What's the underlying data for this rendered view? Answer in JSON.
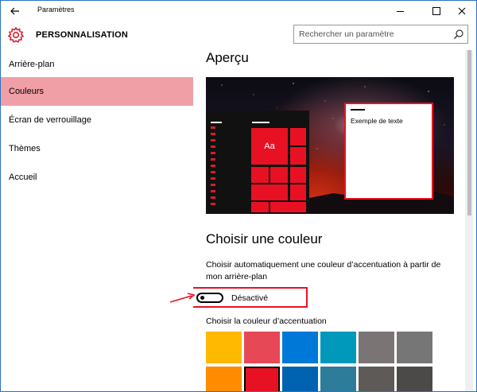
{
  "window": {
    "title": "Paramètres",
    "back_icon": "arrow-left-icon",
    "controls": [
      "minimize-icon",
      "maximize-icon",
      "close-icon"
    ]
  },
  "header": {
    "icon": "gear-icon",
    "title": "PERSONNALISATION",
    "search_placeholder": "Rechercher un paramètre",
    "search_icon": "search-icon",
    "accent": "#d61e2b"
  },
  "sidebar": {
    "items": [
      {
        "label": "Arrière-plan",
        "active": false
      },
      {
        "label": "Couleurs",
        "active": true
      },
      {
        "label": "Écran de verrouillage",
        "active": false
      },
      {
        "label": "Thèmes",
        "active": false
      },
      {
        "label": "Accueil",
        "active": false
      }
    ],
    "active_color": "#ef9fa5"
  },
  "main": {
    "preview_heading": "Aperçu",
    "preview": {
      "tile_text": "Aa",
      "window_text": "Exemple de texte",
      "accent_color": "#e81123"
    },
    "choose_heading": "Choisir une couleur",
    "auto_description": "Choisir automatiquement une couleur d’accentuation à partir de mon arrière-plan",
    "toggle": {
      "state": "off",
      "label": "Désactivé"
    },
    "accent_label": "Choisir la couleur d’accentuation",
    "swatches": [
      {
        "color": "#ffb900",
        "selected": false
      },
      {
        "color": "#e74856",
        "selected": false
      },
      {
        "color": "#0078d7",
        "selected": false
      },
      {
        "color": "#0099bc",
        "selected": false
      },
      {
        "color": "#7a7574",
        "selected": false
      },
      {
        "color": "#767676",
        "selected": false
      },
      {
        "color": "#ff8c00",
        "selected": false
      },
      {
        "color": "#e81123",
        "selected": true
      },
      {
        "color": "#0063b1",
        "selected": false
      },
      {
        "color": "#2d7d9a",
        "selected": false
      },
      {
        "color": "#5d5a58",
        "selected": false
      },
      {
        "color": "#4c4a48",
        "selected": false
      }
    ]
  },
  "annotation": {
    "arrow_color": "#e81123"
  }
}
